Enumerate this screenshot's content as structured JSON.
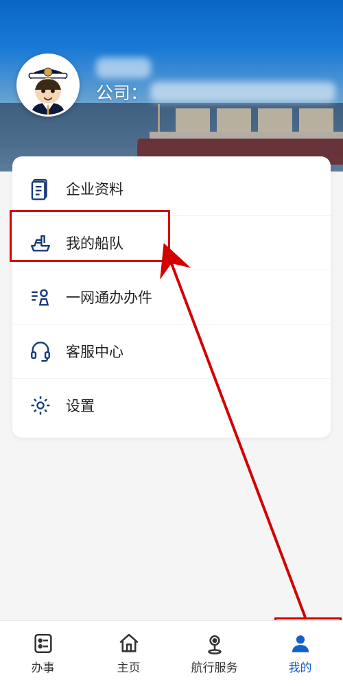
{
  "header": {
    "company_prefix": "公司：",
    "user_name_redacted": true,
    "company_name_redacted": true
  },
  "menu": {
    "items": [
      {
        "id": "company-profile",
        "label": "企业资料",
        "icon": "document-icon",
        "highlighted": false
      },
      {
        "id": "my-fleet",
        "label": "我的船队",
        "icon": "ship-icon",
        "highlighted": true
      },
      {
        "id": "one-stop-cases",
        "label": "一网通办办件",
        "icon": "stamp-icon",
        "highlighted": false
      },
      {
        "id": "support-center",
        "label": "客服中心",
        "icon": "headset-icon",
        "highlighted": false
      },
      {
        "id": "settings",
        "label": "设置",
        "icon": "gear-icon",
        "highlighted": false
      }
    ]
  },
  "nav": {
    "items": [
      {
        "id": "affairs",
        "label": "办事",
        "icon": "form-icon",
        "active": false
      },
      {
        "id": "home",
        "label": "主页",
        "icon": "home-icon",
        "active": false
      },
      {
        "id": "sailing",
        "label": "航行服务",
        "icon": "pin-icon",
        "active": false
      },
      {
        "id": "mine",
        "label": "我的",
        "icon": "person-icon",
        "active": true
      }
    ]
  },
  "annotation": {
    "arrow_from": "nav.mine",
    "arrow_to": "menu.my-fleet",
    "color": "#d40000"
  },
  "colors": {
    "primary": "#173a7a",
    "accent": "#1261c9",
    "danger": "#d40000"
  }
}
